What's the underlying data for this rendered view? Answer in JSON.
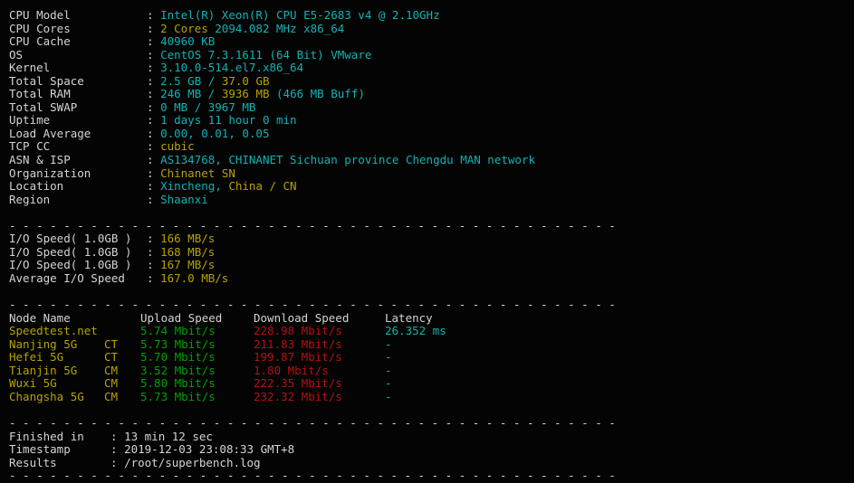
{
  "terminal": {
    "separator": "- - - - - - - - - - - - - - - - - - - - - - - - - - - - - - - - - - - - - - - - - - - - -",
    "colon": ":"
  },
  "system_info": [
    {
      "label": "CPU Model",
      "parts": [
        {
          "text": "Intel(R) Xeon(R) CPU E5-2683 v4 @ 2.10GHz",
          "color": "cyan"
        }
      ]
    },
    {
      "label": "CPU Cores",
      "parts": [
        {
          "text": "2 Cores ",
          "color": "yellow"
        },
        {
          "text": "2094.082 MHz x86_64",
          "color": "cyan"
        }
      ]
    },
    {
      "label": "CPU Cache",
      "parts": [
        {
          "text": "40960 KB",
          "color": "cyan"
        }
      ]
    },
    {
      "label": "OS",
      "parts": [
        {
          "text": "CentOS 7.3.1611 (64 Bit) VMware",
          "color": "cyan"
        }
      ]
    },
    {
      "label": "Kernel",
      "parts": [
        {
          "text": "3.10.0-514.el7.x86_64",
          "color": "cyan"
        }
      ]
    },
    {
      "label": "Total Space",
      "parts": [
        {
          "text": "2.5 GB ",
          "color": "cyan"
        },
        {
          "text": "/ ",
          "color": "cyan"
        },
        {
          "text": "37.0 GB",
          "color": "yellow"
        }
      ]
    },
    {
      "label": "Total RAM",
      "parts": [
        {
          "text": "246 MB ",
          "color": "cyan"
        },
        {
          "text": "/ ",
          "color": "cyan"
        },
        {
          "text": "3936 MB ",
          "color": "yellow"
        },
        {
          "text": "(466 MB Buff)",
          "color": "cyan"
        }
      ]
    },
    {
      "label": "Total SWAP",
      "parts": [
        {
          "text": "0 MB / 3967 MB",
          "color": "cyan"
        }
      ]
    },
    {
      "label": "Uptime",
      "parts": [
        {
          "text": "1 days 11 hour 0 min",
          "color": "cyan"
        }
      ]
    },
    {
      "label": "Load Average",
      "parts": [
        {
          "text": "0.00, 0.01, 0.05",
          "color": "cyan"
        }
      ]
    },
    {
      "label": "TCP CC",
      "parts": [
        {
          "text": "cubic",
          "color": "yellow"
        }
      ]
    },
    {
      "label": "ASN & ISP",
      "parts": [
        {
          "text": "AS134768, CHINANET Sichuan province Chengdu MAN network",
          "color": "cyan"
        }
      ]
    },
    {
      "label": "Organization",
      "parts": [
        {
          "text": "Chinanet SN",
          "color": "yellow"
        }
      ]
    },
    {
      "label": "Location",
      "parts": [
        {
          "text": "Xincheng, ",
          "color": "cyan"
        },
        {
          "text": "China / CN",
          "color": "yellow"
        }
      ]
    },
    {
      "label": "Region",
      "parts": [
        {
          "text": "Shaanxi",
          "color": "cyan"
        }
      ]
    }
  ],
  "io_section": {
    "rows": [
      {
        "label": "I/O Speed( 1.0GB )",
        "value": "166 MB/s"
      },
      {
        "label": "I/O Speed( 1.0GB )",
        "value": "168 MB/s"
      },
      {
        "label": "I/O Speed( 1.0GB )",
        "value": "167 MB/s"
      },
      {
        "label": "Average I/O Speed",
        "value": "167.0 MB/s"
      }
    ]
  },
  "speedtest": {
    "headers": {
      "node": "Node Name",
      "upload": "Upload Speed",
      "download": "Download Speed",
      "latency": "Latency"
    },
    "rows": [
      {
        "node": "Speedtest.net",
        "cc": "",
        "upload": "5.74 Mbit/s",
        "download": "228.98 Mbit/s",
        "latency": "26.352 ms"
      },
      {
        "node": "Nanjing 5G",
        "cc": "CT",
        "upload": "5.73 Mbit/s",
        "download": "211.83 Mbit/s",
        "latency": "-"
      },
      {
        "node": "Hefei 5G",
        "cc": "CT",
        "upload": "5.70 Mbit/s",
        "download": "199.87 Mbit/s",
        "latency": "-"
      },
      {
        "node": "Tianjin 5G",
        "cc": "CM",
        "upload": "3.52 Mbit/s",
        "download": "1.80 Mbit/s",
        "latency": "-"
      },
      {
        "node": "Wuxi 5G",
        "cc": "CM",
        "upload": "5.80 Mbit/s",
        "download": "222.35 Mbit/s",
        "latency": "-"
      },
      {
        "node": "Changsha 5G",
        "cc": "CM",
        "upload": "5.73 Mbit/s",
        "download": "232.32 Mbit/s",
        "latency": "-"
      }
    ]
  },
  "footer": [
    {
      "label": "Finished in",
      "value": "13 min 12 sec"
    },
    {
      "label": "Timestamp",
      "value": "2019-12-03 23:08:33 GMT+8"
    },
    {
      "label": "Results",
      "value": "/root/superbench.log"
    }
  ],
  "colors": {
    "background": "#040404",
    "foreground": "#d4d4d4",
    "cyan": "#12b2b2",
    "yellow": "#b5a300",
    "green": "#00a000",
    "red": "#b41111"
  }
}
